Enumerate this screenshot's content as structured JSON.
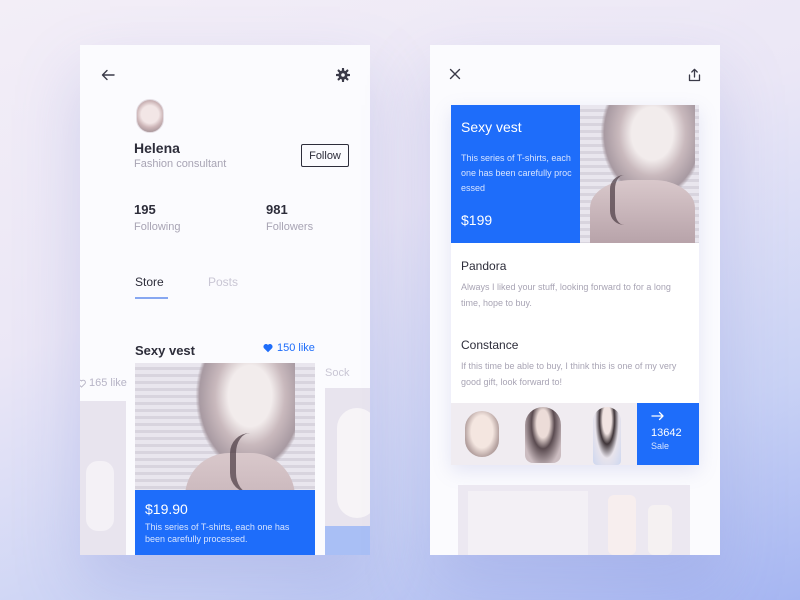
{
  "profile_screen": {
    "back_icon": "arrow-left-icon",
    "settings_icon": "gear-icon",
    "user": {
      "name": "Helena",
      "role": "Fashion consultant",
      "follow_label": "Follow"
    },
    "stats": [
      {
        "value": "195",
        "label": "Following"
      },
      {
        "value": "981",
        "label": "Followers"
      }
    ],
    "tabs": [
      {
        "label": "Store",
        "active": true
      },
      {
        "label": "Posts",
        "active": false
      }
    ],
    "products": {
      "current": {
        "title": "Sexy vest",
        "likes": "150 like",
        "price": "$19.90",
        "description": "This series of T-shirts, each one has been carefully processed."
      },
      "previous_likes": "165 like",
      "next_title": "Sock"
    }
  },
  "detail_screen": {
    "close_icon": "close-icon",
    "share_icon": "share-icon",
    "product": {
      "title": "Sexy vest",
      "description": "This series of T-shirts, each one has been carefully processed",
      "price": "$199"
    },
    "comments": [
      {
        "name": "Pandora",
        "text": "Always I liked your stuff, looking forward to for a long time, hope to buy."
      },
      {
        "name": "Constance",
        "text": "If this time be able to buy, I think this is one of my very good gift, look forward to!"
      }
    ],
    "sale": {
      "arrow_icon": "arrow-right-icon",
      "count": "13642",
      "label": "Sale"
    }
  },
  "colors": {
    "accent": "#1e6dfa",
    "text_dark": "#2d2d3a",
    "text_muted": "#a8a4b4"
  }
}
